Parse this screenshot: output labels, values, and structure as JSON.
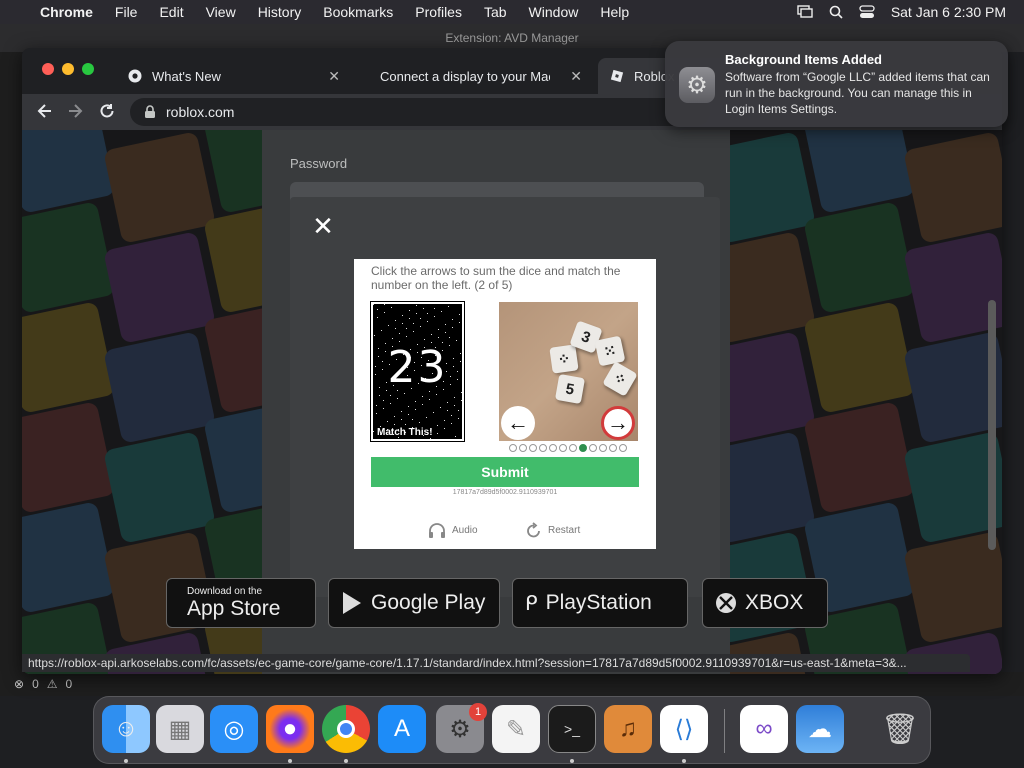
{
  "menubar": {
    "apple_icon": "apple-icon",
    "app_name": "Chrome",
    "items": [
      "File",
      "Edit",
      "View",
      "History",
      "Bookmarks",
      "Profiles",
      "Tab",
      "Window",
      "Help"
    ],
    "clock": "Sat Jan 6  2:30 PM"
  },
  "vscode": {
    "title": "Extension: AVD Manager",
    "status_errors": "0",
    "status_warnings": "0"
  },
  "chrome": {
    "tabs": [
      {
        "title": "What's New"
      },
      {
        "title": "Connect a display to your Mac"
      },
      {
        "title": "Roblox"
      }
    ],
    "url": "roblox.com",
    "status_url": "https://roblox-api.arkoselabs.com/fc/assets/ec-game-core/game-core/1.17.1/standard/index.html?session=17817a7d89d5f0002.9110939701&r=us-east-1&meta=3&..."
  },
  "login": {
    "password_label": "Password"
  },
  "captcha": {
    "instruction": "Click the arrows to sum the dice and match the number on the left. (2 of 5)",
    "target_number": "23",
    "target_label": "Match This!",
    "dice": [
      "5",
      "3"
    ],
    "progress_total": 12,
    "progress_current": 8,
    "submit_label": "Submit",
    "session_id": "17817a7d89d5f0002.9110939701",
    "audio_label": "Audio",
    "restart_label": "Restart"
  },
  "stores": [
    {
      "small": "Download on the",
      "big": "App Store"
    },
    {
      "small": "",
      "big": "Google Play"
    },
    {
      "small": "",
      "big": "PlayStation"
    },
    {
      "small": "",
      "big": "XBOX"
    }
  ],
  "notification": {
    "title": "Background Items Added",
    "body": "Software from “Google LLC” added items that can run in the background. You can manage this in Login Items Settings."
  },
  "dock": {
    "apps": [
      "Finder",
      "Launchpad",
      "Safari",
      "Firefox",
      "Google Chrome",
      "App Store",
      "System Settings",
      "TextEdit",
      "Terminal",
      "GarageBand",
      "Visual Studio Code",
      "Visual Studio",
      "Weather",
      "Trash"
    ],
    "settings_badge": "1"
  }
}
